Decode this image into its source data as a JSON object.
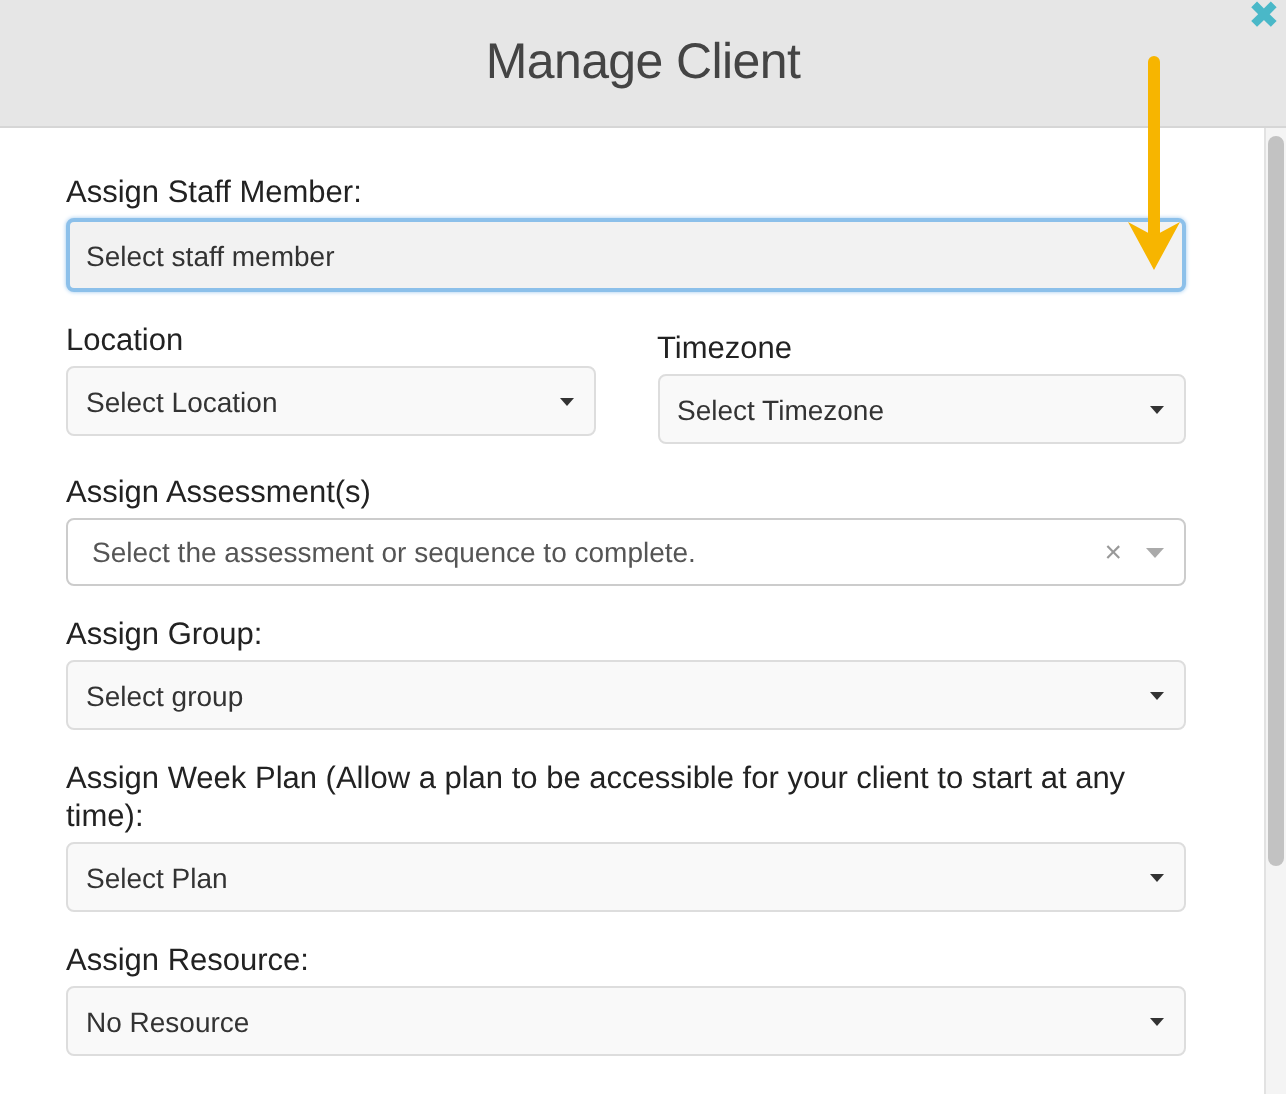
{
  "dialog": {
    "title": "Manage Client",
    "close": "✖"
  },
  "fields": [
    {
      "kind": "select",
      "label": "Assign Staff Member:",
      "value": "Select staff member",
      "focused": true
    },
    {
      "kind": "pair",
      "items": [
        {
          "kind": "select",
          "label": "Location",
          "value": "Select Location",
          "focused": false
        },
        {
          "kind": "select",
          "label": "Timezone",
          "value": "Select Timezone",
          "focused": false
        }
      ]
    },
    {
      "kind": "multiselect",
      "label": "Assign Assessment(s)",
      "placeholder": "Select the assessment or sequence to complete.",
      "clear": "×",
      "focused": false
    },
    {
      "kind": "select",
      "label": "Assign Group:",
      "value": "Select group",
      "focused": false
    },
    {
      "kind": "select",
      "label": "Assign Week Plan (Allow a plan to be accessible for your client to start at any time):",
      "value": "Select Plan",
      "focused": false
    },
    {
      "kind": "select",
      "label": "Assign Resource:",
      "value": "No Resource",
      "focused": false
    }
  ]
}
